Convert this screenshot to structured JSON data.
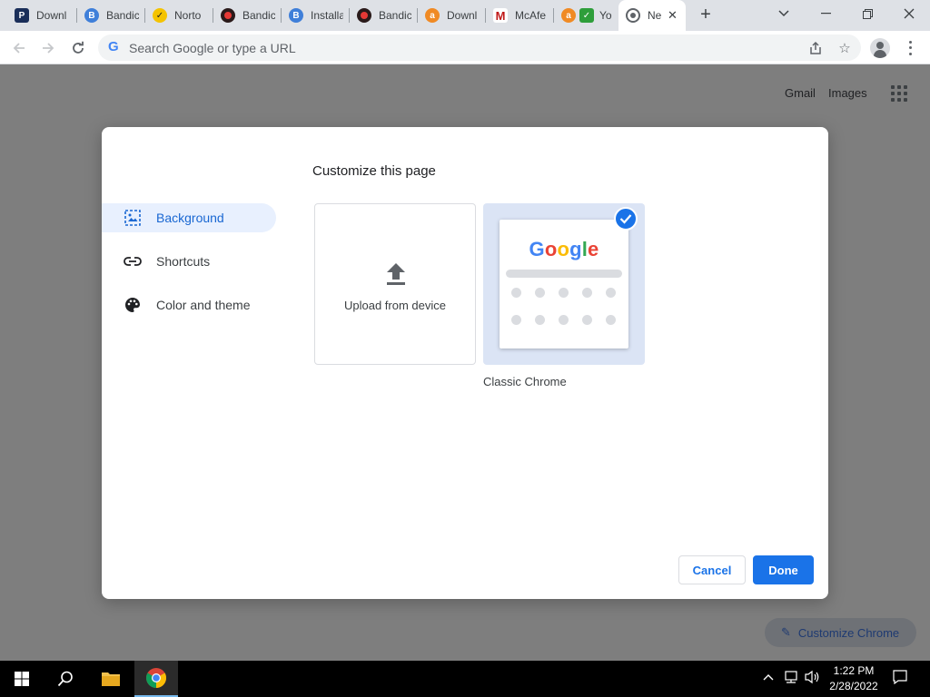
{
  "tabs": [
    {
      "label": "Downl",
      "icon": "pdf-icon",
      "color": "#1a2e59"
    },
    {
      "label": "Bandic",
      "icon": "bandicam-b-icon",
      "color": "#3f7fd9"
    },
    {
      "label": "Norto",
      "icon": "norton-check-icon",
      "color": "#f4c300"
    },
    {
      "label": "Bandic",
      "icon": "bandicam-record-icon",
      "color": "#c62828"
    },
    {
      "label": "Installa",
      "icon": "bandicam-b-icon",
      "color": "#3f7fd9"
    },
    {
      "label": "Bandic",
      "icon": "bandicam-record-icon",
      "color": "#c62828"
    },
    {
      "label": "Downl",
      "icon": "avast-icon",
      "color": "#f08a24"
    },
    {
      "label": "McAfe",
      "icon": "mcafee-icon",
      "color": "#c01818"
    },
    {
      "label": "Yo",
      "icon": "avast-check-icon",
      "color": "#f08a24"
    },
    {
      "label": "Ne",
      "icon": "chrome-icon",
      "color": "#5f6368",
      "active": true
    }
  ],
  "omnibox": {
    "placeholder": "Search Google or type a URL"
  },
  "page": {
    "gmail": "Gmail",
    "images": "Images",
    "customize_chrome": "Customize Chrome"
  },
  "dialog": {
    "title": "Customize this page",
    "menu": [
      {
        "label": "Background",
        "icon": "image-icon",
        "selected": true
      },
      {
        "label": "Shortcuts",
        "icon": "link-icon",
        "selected": false
      },
      {
        "label": "Color and theme",
        "icon": "palette-icon",
        "selected": false
      }
    ],
    "upload_label": "Upload from device",
    "classic_label": "Classic Chrome",
    "mini_logo": "Google",
    "cancel": "Cancel",
    "done": "Done"
  },
  "taskbar": {
    "time": "1:22 PM",
    "date": "2/28/2022"
  },
  "colors": {
    "accent": "#1a73e8",
    "selected_bg": "#e8f0fe",
    "overlay": "#7e7e7e"
  }
}
